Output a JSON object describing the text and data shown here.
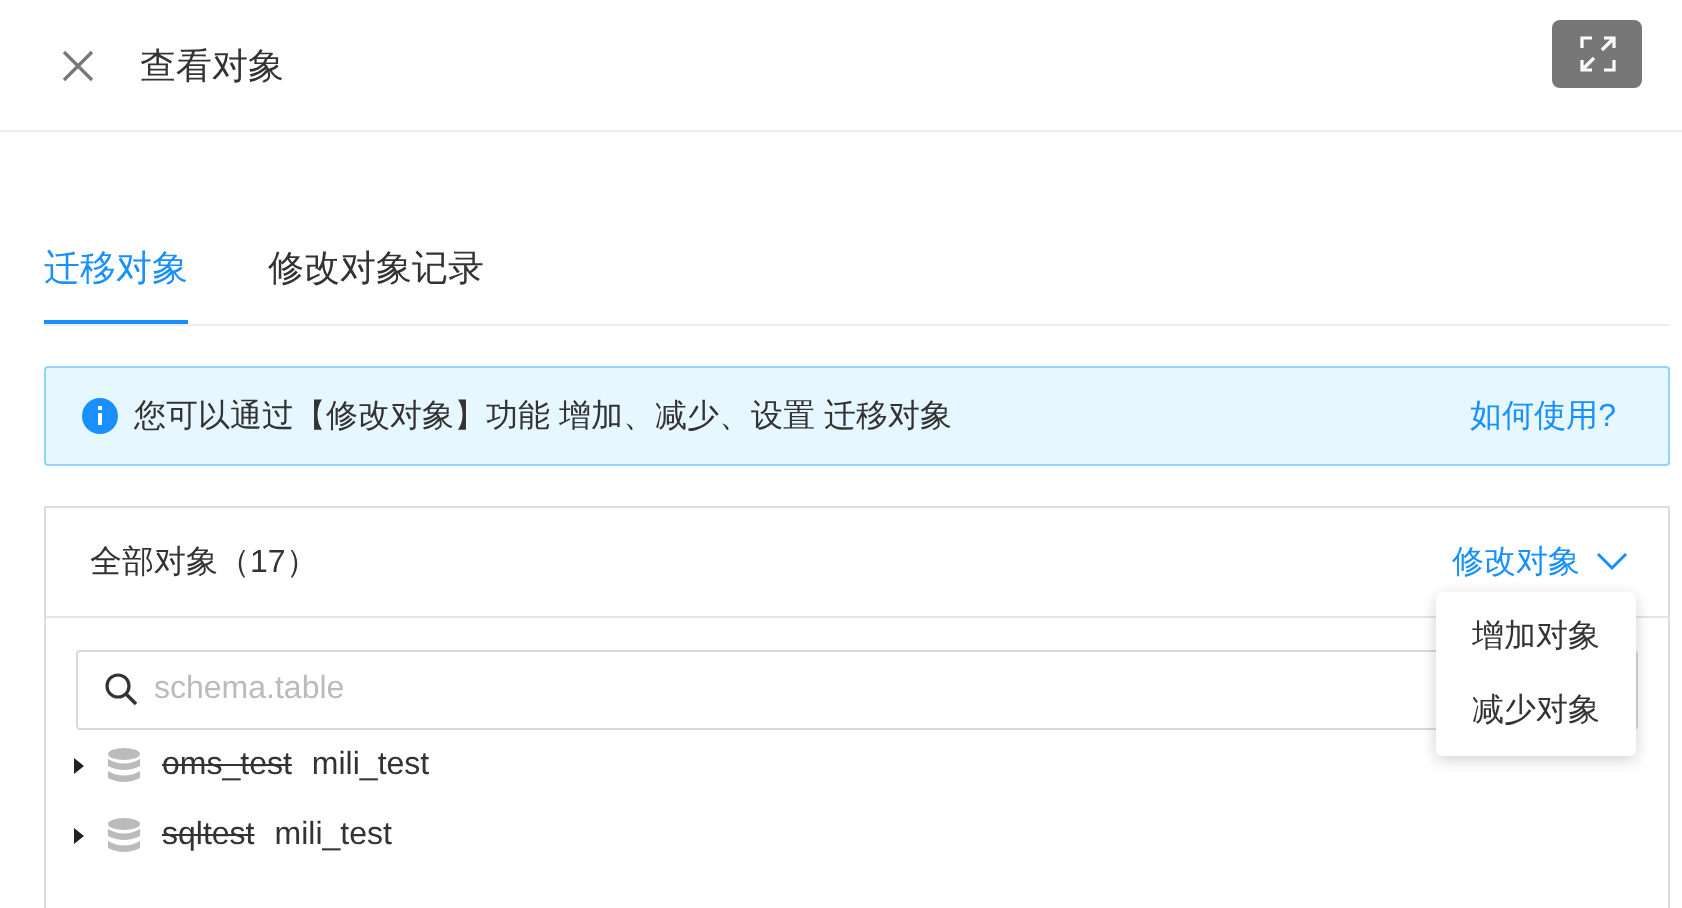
{
  "dialog": {
    "title": "查看对象"
  },
  "tabs": [
    {
      "label": "迁移对象",
      "selected": true
    },
    {
      "label": "修改对象记录",
      "selected": false
    }
  ],
  "alert": {
    "message": "您可以通过【修改对象】功能 增加、减少、设置 迁移对象",
    "link": "如何使用?"
  },
  "panel": {
    "title": "全部对象（17）",
    "action": "修改对象",
    "menu": [
      "增加对象",
      "减少对象"
    ]
  },
  "search": {
    "placeholder": "schema.table"
  },
  "tree": [
    {
      "source": "oms_test",
      "target": "mili_test",
      "expanded": false
    },
    {
      "source": "sqltest",
      "target": "mili_test",
      "expanded": false
    }
  ]
}
